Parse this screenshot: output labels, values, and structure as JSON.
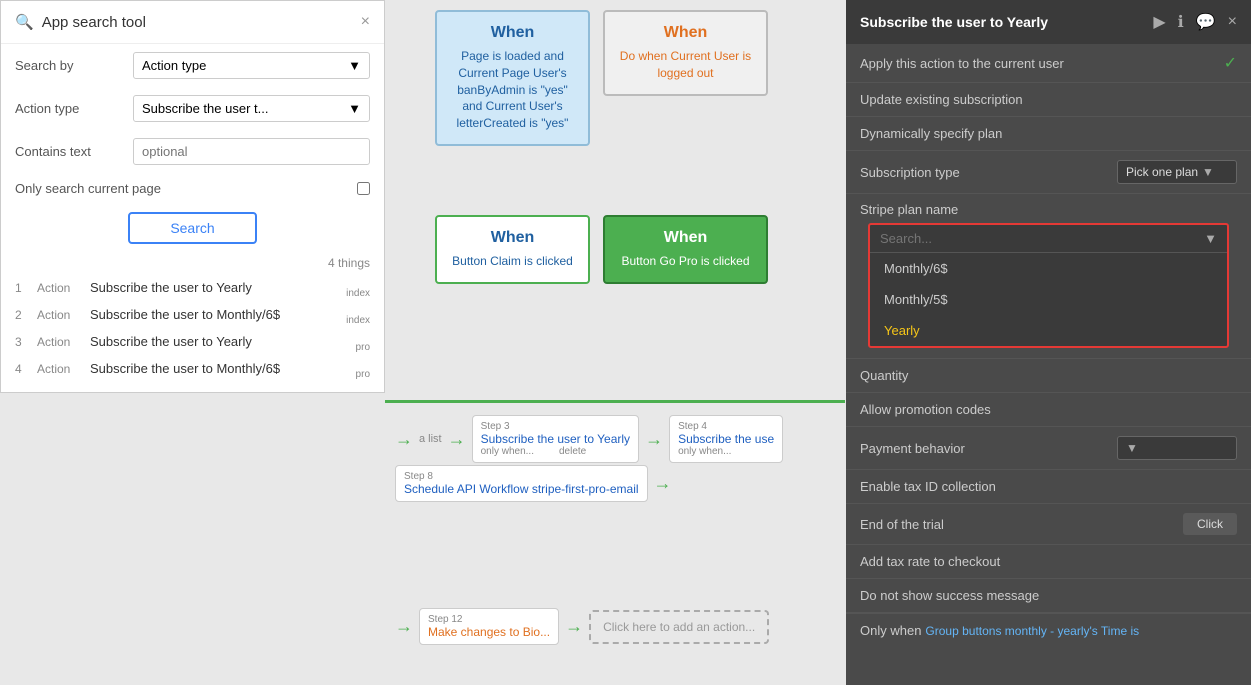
{
  "leftPanel": {
    "title": "App search tool",
    "close": "×",
    "searchBy": {
      "label": "Search by",
      "value": "Action type",
      "arrow": "▼"
    },
    "actionType": {
      "label": "Action type",
      "value": "Subscribe the user t...",
      "arrow": "▼"
    },
    "containsText": {
      "label": "Contains text",
      "placeholder": "optional"
    },
    "onlyCurrentPage": {
      "label": "Only search current page"
    },
    "searchButton": "Search",
    "resultsCount": "4 things",
    "results": [
      {
        "num": "1",
        "type": "Action",
        "name": "Subscribe the user to Yearly",
        "tag": "index"
      },
      {
        "num": "2",
        "type": "Action",
        "name": "Subscribe the user to Monthly/6$",
        "tag": "index"
      },
      {
        "num": "3",
        "type": "Action",
        "name": "Subscribe the user to Yearly",
        "tag": "pro"
      },
      {
        "num": "4",
        "type": "Action",
        "name": "Subscribe the user to Monthly/6$",
        "tag": "pro"
      }
    ]
  },
  "canvas": {
    "whenCards": [
      {
        "id": "card1",
        "type": "blue",
        "title": "When",
        "body": "Page is loaded and Current Page User's banByAdmin is \"yes\" and Current User's letterCreated is \"yes\""
      },
      {
        "id": "card2",
        "type": "gray",
        "title": "When",
        "body": "Do when Current User is logged out"
      },
      {
        "id": "card3",
        "type": "white-green",
        "title": "When",
        "body": "Button Claim is clicked"
      },
      {
        "id": "card4",
        "type": "green",
        "title": "When",
        "body": "Button Go Pro is clicked"
      }
    ],
    "steps": [
      {
        "num": "Step 3",
        "name": "Subscribe the user to Yearly",
        "sub": "only when...",
        "tag": "delete"
      },
      {
        "num": "Step 4",
        "name": "Subscribe the use",
        "sub": "only when...",
        "tag": ""
      }
    ],
    "step8": {
      "num": "Step 8",
      "name": "Schedule API Workflow stripe-first-pro-email"
    },
    "step12": {
      "num": "Step 12",
      "name": "Make changes to Bio..."
    },
    "addAction": "Click here to add an action..."
  },
  "rightPanel": {
    "title": "Subscribe the user to Yearly",
    "icons": {
      "play": "▶",
      "info": "ℹ",
      "chat": "💬",
      "close": "×"
    },
    "rows": [
      {
        "label": "Apply this action to the current user",
        "control": "check"
      },
      {
        "label": "Update existing subscription",
        "control": "toggle"
      },
      {
        "label": "Dynamically specify plan",
        "control": "toggle"
      },
      {
        "label": "Subscription type",
        "control": "select",
        "value": "Pick one plan"
      }
    ],
    "stripePlanRow": {
      "label": "Stripe plan name",
      "searchPlaceholder": "Search...",
      "options": [
        {
          "value": "Monthly/6$",
          "selected": false
        },
        {
          "value": "Monthly/5$",
          "selected": false
        },
        {
          "value": "Yearly",
          "selected": true
        }
      ]
    },
    "quantityRow": {
      "label": "Quantity",
      "control": "toggle"
    },
    "allowPromotionRow": {
      "label": "Allow promotion codes",
      "control": "toggle"
    },
    "paymentBehaviorRow": {
      "label": "Payment behavior",
      "control": "select"
    },
    "enableTaxRow": {
      "label": "Enable tax ID collection",
      "control": "toggle"
    },
    "endTrialRow": {
      "label": "End of the trial",
      "btnLabel": "Click"
    },
    "addTaxRow": {
      "label": "Add tax rate to checkout",
      "control": "toggle"
    },
    "noSuccessRow": {
      "label": "Do not show success message",
      "control": "toggle"
    },
    "onlyWhen": {
      "label": "Only when",
      "link": "Group buttons monthly - yearly's Time is"
    }
  }
}
